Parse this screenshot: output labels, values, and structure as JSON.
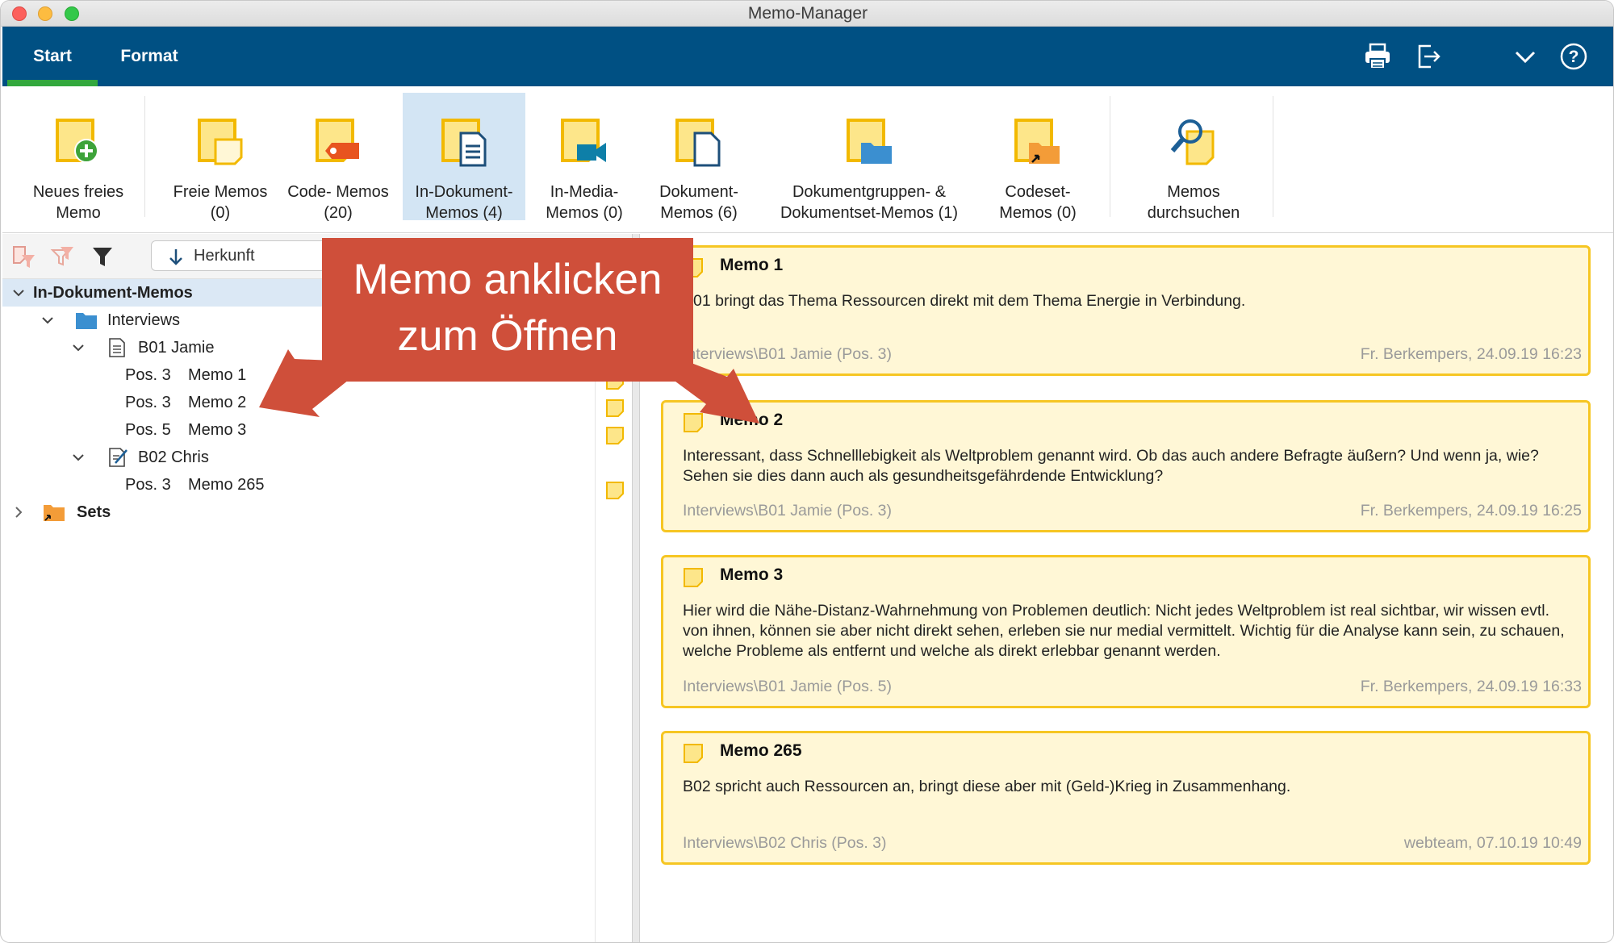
{
  "window": {
    "title": "Memo-Manager"
  },
  "ribbon": {
    "tabs": [
      {
        "label": "Start"
      },
      {
        "label": "Format"
      }
    ]
  },
  "toolbar": {
    "buttons": [
      {
        "line1": "Neues freies",
        "line2": "Memo"
      },
      {
        "line1": "Freie Memos",
        "line2": "(0)"
      },
      {
        "line1": "Code- Memos",
        "line2": "(20)"
      },
      {
        "line1": "In-Dokument-",
        "line2": "Memos (4)"
      },
      {
        "line1": "In-Media-",
        "line2": "Memos (0)"
      },
      {
        "line1": "Dokument-",
        "line2": "Memos (6)"
      },
      {
        "line1": "Dokumentgruppen- &",
        "line2": "Dokumentset-Memos (1)"
      },
      {
        "line1": "Codeset-",
        "line2": "Memos (0)"
      },
      {
        "line1": "Memos",
        "line2": "durchsuchen"
      }
    ]
  },
  "filter": {
    "sort_label": "Herkunft"
  },
  "tree": {
    "root": "In-Dokument-Memos",
    "group": "Interviews",
    "docs": [
      {
        "name": "B01 Jamie",
        "memos": [
          {
            "pos": "Pos. 3",
            "name": "Memo 1"
          },
          {
            "pos": "Pos. 3",
            "name": "Memo 2"
          },
          {
            "pos": "Pos. 5",
            "name": "Memo 3"
          }
        ]
      },
      {
        "name": "B02 Chris",
        "memos": [
          {
            "pos": "Pos. 3",
            "name": "Memo 265"
          }
        ]
      }
    ],
    "sets": "Sets"
  },
  "memos": [
    {
      "title": "Memo 1",
      "body": "B01 bringt das Thema Ressourcen direkt mit dem Thema Energie in Verbindung.",
      "path": "Interviews\\B01 Jamie (Pos. 3)",
      "author": "Fr. Berkempers, 24.09.19 16:23"
    },
    {
      "title": "Memo 2",
      "body": "Interessant, dass Schnelllebigkeit als Weltproblem genannt wird. Ob das auch andere Befragte äußern? Und wenn ja, wie? Sehen sie dies dann auch als gesundheitsgefährdende Entwicklung?",
      "path": "Interviews\\B01 Jamie (Pos. 3)",
      "author": "Fr. Berkempers, 24.09.19 16:25"
    },
    {
      "title": "Memo 3",
      "body": "Hier wird die Nähe-Distanz-Wahrnehmung von Problemen deutlich: Nicht jedes Weltproblem ist real sichtbar, wir wissen evtl. von ihnen, können sie aber nicht direkt sehen, erleben sie nur medial vermittelt. Wichtig für die Analyse kann sein, zu schauen, welche Probleme als entfernt und welche als direkt erlebbar genannt werden.",
      "path": "Interviews\\B01 Jamie (Pos. 5)",
      "author": "Fr. Berkempers, 24.09.19 16:33"
    },
    {
      "title": "Memo 265",
      "body": "B02 spricht auch Ressourcen an, bringt diese aber mit (Geld-)Krieg in Zusammenhang.",
      "path": "Interviews\\B02 Chris (Pos. 3)",
      "author": "webteam, 07.10.19 10:49"
    }
  ],
  "callout": {
    "line1": "Memo anklicken",
    "line2": "zum Öffnen"
  },
  "colors": {
    "ribbon": "#005083",
    "accent_green": "#33a83d",
    "memo_border": "#f6c623",
    "memo_fill": "#fff7d6",
    "callout": "#cf4f3a"
  }
}
